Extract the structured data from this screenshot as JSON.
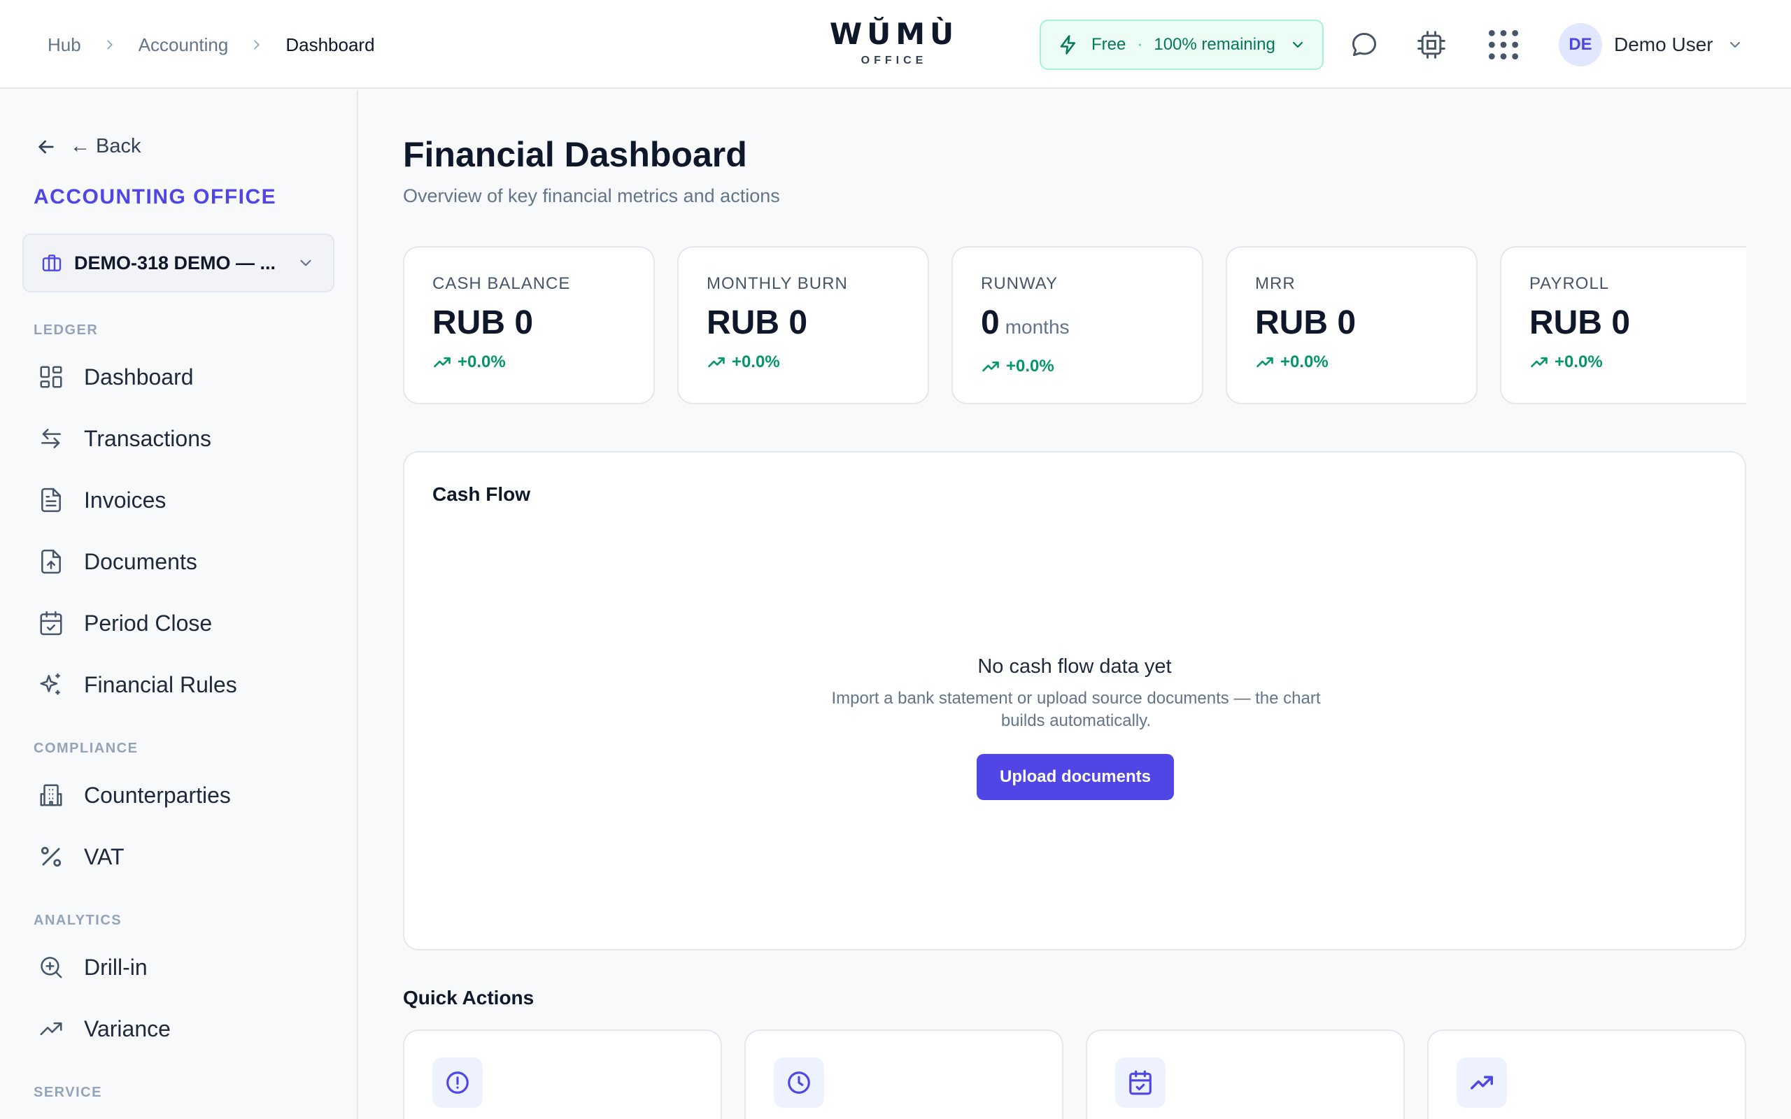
{
  "breadcrumb": {
    "hub": "Hub",
    "section": "Accounting",
    "current": "Dashboard"
  },
  "brand": {
    "name": "WŬMÙ",
    "sub": "OFFICE"
  },
  "plan": {
    "tier": "Free",
    "separator": "·",
    "remaining": "100% remaining"
  },
  "user": {
    "initials": "DE",
    "name": "Demo User"
  },
  "sidebar": {
    "back_label": "← Back",
    "office_title": "ACCOUNTING OFFICE",
    "company": "DEMO-318 DEMO — ...",
    "sections": {
      "ledger": "LEDGER",
      "compliance": "COMPLIANCE",
      "analytics": "ANALYTICS",
      "service": "SERVICE"
    },
    "items": {
      "dashboard": "Dashboard",
      "transactions": "Transactions",
      "invoices": "Invoices",
      "documents": "Documents",
      "period_close": "Period Close",
      "financial_rules": "Financial Rules",
      "counterparties": "Counterparties",
      "vat": "VAT",
      "drill_in": "Drill-in",
      "variance": "Variance"
    }
  },
  "main": {
    "title": "Financial Dashboard",
    "subtitle": "Overview of key financial metrics and actions",
    "metrics": [
      {
        "label": "CASH BALANCE",
        "value": "RUB 0",
        "unit": "",
        "change": "+0.0%"
      },
      {
        "label": "MONTHLY BURN",
        "value": "RUB 0",
        "unit": "",
        "change": "+0.0%"
      },
      {
        "label": "RUNWAY",
        "value": "0",
        "unit": "months",
        "change": "+0.0%"
      },
      {
        "label": "MRR",
        "value": "RUB 0",
        "unit": "",
        "change": "+0.0%"
      },
      {
        "label": "PAYROLL",
        "value": "RUB 0",
        "unit": "",
        "change": "+0.0%"
      }
    ],
    "cashflow": {
      "title": "Cash Flow",
      "empty_title": "No cash flow data yet",
      "empty_desc": "Import a bank statement or upload source documents — the chart builds automatically.",
      "upload_label": "Upload documents"
    },
    "quick_actions_title": "Quick Actions"
  },
  "colors": {
    "accent": "#4f46e5",
    "success": "#059669",
    "plan_bg": "#ecfdf5"
  }
}
